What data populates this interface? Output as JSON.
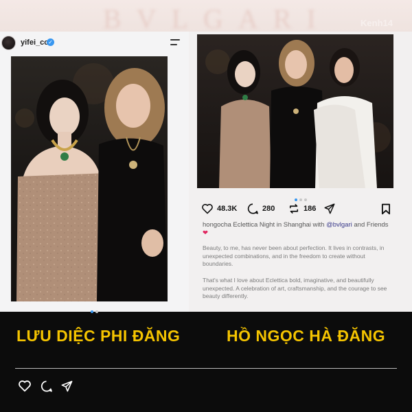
{
  "backdrop": {
    "ghost_text": "BVLGARI",
    "brand": "Kenh14"
  },
  "left_post": {
    "username": "yifei_cc",
    "carousel_dots": 2,
    "active_dot": 0
  },
  "right_post": {
    "carousel_dots": 3,
    "active_dot": 0,
    "likes": "48.3K",
    "comments": "280",
    "reposts": "186",
    "caption_user": "hongocha",
    "caption_text": " Eclettica Night in Shanghai with ",
    "caption_mention": "@bvlgari",
    "caption_tail": " and Friends",
    "caption_emoji": "❤",
    "paragraph_1": "Beauty, to me, has never been about perfection. It lives in contrasts, in unexpected combinations, and in the freedom to create without boundaries.",
    "paragraph_2": "That's what I love about Eclettica bold, imaginative, and beautifully unexpected. A celebration of art, craftsmanship, and the courage to see beauty differently."
  },
  "labels": {
    "left": "LƯU DIỆC PHI ĐĂNG",
    "right": "HỒ NGỌC HÀ ĐĂNG"
  },
  "colors": {
    "accent_yellow": "#f5c400",
    "ig_blue": "#3897f0",
    "heart_red": "#e0245e"
  },
  "icons": [
    "heart-icon",
    "comment-icon",
    "repost-icon",
    "share-icon",
    "bookmark-icon",
    "menu-icon",
    "verified-icon"
  ]
}
